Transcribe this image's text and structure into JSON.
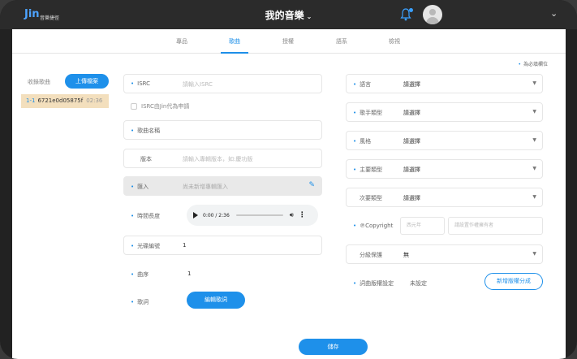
{
  "header": {
    "logo_text": "音樂捷徑",
    "logo_mark": "Jin",
    "title": "我的音樂",
    "title_caret": "⌄",
    "bell_icon": "bell-icon",
    "avatar_icon": "user-avatar-icon",
    "menu_chevron": "⌄"
  },
  "tabs": [
    {
      "label": "專品",
      "active": false
    },
    {
      "label": "歌曲",
      "active": true
    },
    {
      "label": "授權",
      "active": false
    },
    {
      "label": "語系",
      "active": false
    },
    {
      "label": "檢視",
      "active": false
    }
  ],
  "required_note": "為必填欄位",
  "song_list": {
    "label": "收錄歌曲",
    "upload_label": "上傳檔案",
    "items": [
      {
        "number": "1-1",
        "name": "6721e0d05875f",
        "duration": "02:36"
      }
    ]
  },
  "form_left": {
    "isrc": {
      "label": "ISRC",
      "placeholder": "請輸入ISRC"
    },
    "isrc_checkbox": "ISRC由Jin代為申請",
    "song_name": {
      "label": "歌曲名稱"
    },
    "version": {
      "label": "版本",
      "placeholder": "請輸入專輯版本，如:慶功版"
    },
    "import": {
      "label": "匯入",
      "placeholder": "尚未新增專輯匯入"
    },
    "duration": {
      "label": "時間長度"
    },
    "audio": {
      "time": "0:00 / 2:36"
    },
    "disc_number": {
      "label": "光碟編號",
      "value": "1"
    },
    "track_order": {
      "label": "曲序",
      "value": "1"
    },
    "lyrics": {
      "label": "歌詞",
      "button": "編輯歌詞"
    }
  },
  "form_right": {
    "language": {
      "label": "語言",
      "value": "請選擇"
    },
    "artist_type": {
      "label": "歌手類型",
      "value": "請選擇"
    },
    "style": {
      "label": "風格",
      "value": "請選擇"
    },
    "main_genre": {
      "label": "主要類型",
      "value": "請選擇"
    },
    "sub_genre": {
      "label": "次要類型",
      "value": "請選擇"
    },
    "copyright": {
      "label": "℗Copyright",
      "year_placeholder": "西元年",
      "owner_placeholder": "請設置作權擁有者"
    },
    "rating": {
      "label": "分級保護",
      "value": "無"
    },
    "split_setting": {
      "label": "詞曲版權設定",
      "value": "未設定"
    },
    "split_button": "新增版權分成"
  },
  "save_label": "儲存",
  "colors": {
    "accent": "#1e90ea",
    "header_bg": "#2b2b2b",
    "selected_row": "#f3dfbd"
  }
}
